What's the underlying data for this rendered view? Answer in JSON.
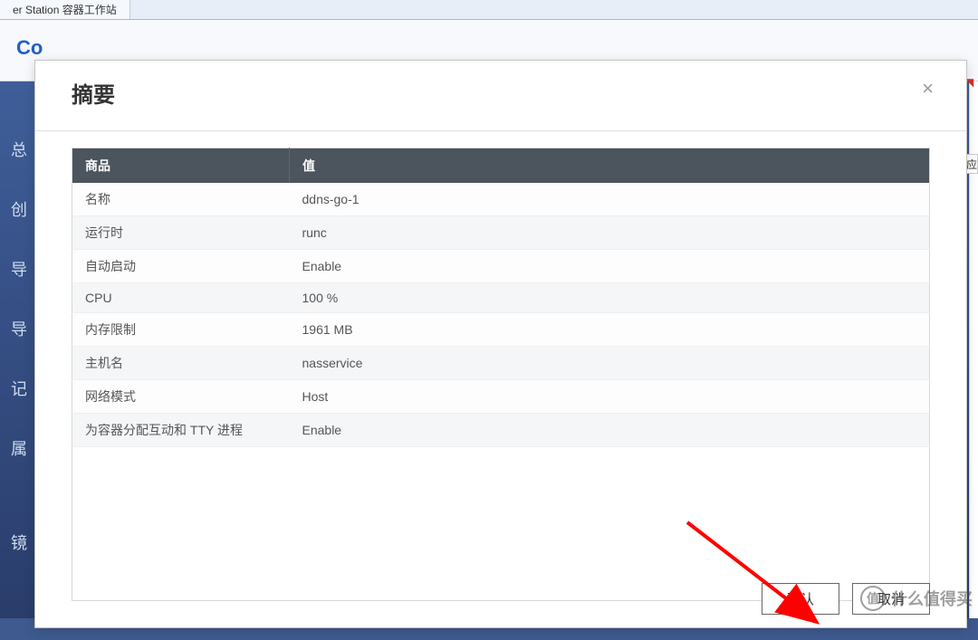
{
  "topTab": {
    "label": "er Station 容器工作站"
  },
  "background": {
    "appTitlePartial": "Co",
    "sidebar": [
      "总",
      "创",
      "导",
      "导",
      "记",
      "属",
      "镜"
    ],
    "rightTab": "应"
  },
  "modal": {
    "title": "摘要",
    "headers": {
      "label": "商品",
      "value": "值"
    },
    "rows": [
      {
        "label": "名称",
        "value": "ddns-go-1"
      },
      {
        "label": "运行时",
        "value": "runc"
      },
      {
        "label": "自动启动",
        "value": "Enable"
      },
      {
        "label": "CPU",
        "value": "100 %"
      },
      {
        "label": "内存限制",
        "value": "1961 MB"
      },
      {
        "label": "主机名",
        "value": "nasservice"
      },
      {
        "label": "网络模式",
        "value": "Host"
      },
      {
        "label": "为容器分配互动和 TTY 进程",
        "value": "Enable"
      }
    ],
    "buttons": {
      "confirm": "确认",
      "cancel": "取消"
    }
  },
  "watermark": {
    "iconText": "值",
    "text": "什么值得买"
  }
}
